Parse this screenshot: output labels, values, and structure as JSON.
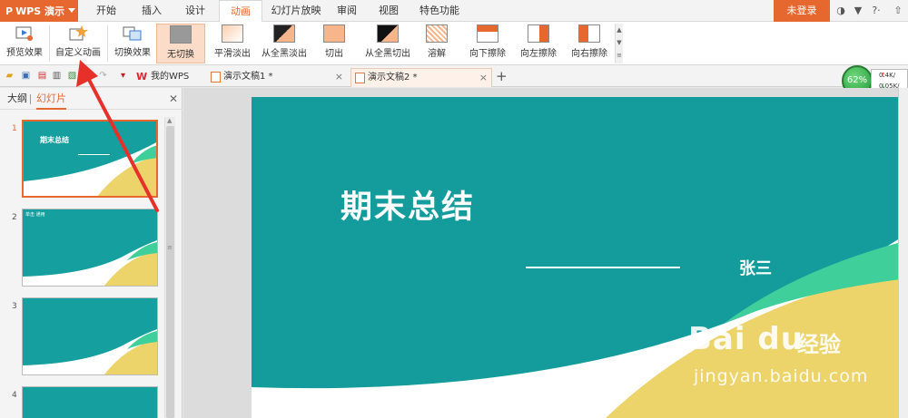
{
  "app": {
    "name": "WPS 演示",
    "logo": "P"
  },
  "menus": [
    {
      "label": "开始"
    },
    {
      "label": "插入"
    },
    {
      "label": "设计"
    },
    {
      "label": "动画"
    },
    {
      "label": "幻灯片放映"
    },
    {
      "label": "审阅"
    },
    {
      "label": "视图"
    },
    {
      "label": "特色功能"
    }
  ],
  "active_menu": "动画",
  "login_label": "未登录",
  "titlebar_icons": [
    "skin-icon",
    "shirt-icon",
    "help-icon",
    "collapse-icon"
  ],
  "ribbon": {
    "preview": "预览效果",
    "custom_animation": "自定义动画",
    "switch_effect": "切换效果",
    "transitions": [
      "无切换",
      "平滑淡出",
      "从全黑淡出",
      "切出",
      "从全黑切出",
      "溶解",
      "向下擦除",
      "向左擦除",
      "向右擦除"
    ]
  },
  "tabs": {
    "wps": "我的WPS",
    "doc1": "演示文稿1 *",
    "doc2": "演示文稿2 *"
  },
  "speed": {
    "percent": "62%",
    "up": "0.4K/",
    "down": "0.05K/"
  },
  "left_pane": {
    "outline_tab": "大纲",
    "slides_tab": "幻灯片"
  },
  "slides": [
    {
      "num": "1",
      "title": "期末总结"
    },
    {
      "num": "2",
      "title": "单击 通用"
    },
    {
      "num": "3"
    },
    {
      "num": "4"
    }
  ],
  "main_slide": {
    "title": "期末总结",
    "author": "张三"
  },
  "watermark": {
    "brand": "Bai du",
    "cn": "经验",
    "url": "jingyan.baidu.com"
  },
  "colors": {
    "accent": "#e7682e",
    "slide_teal": "#149c9c",
    "curve_yellow": "#ecd46a",
    "curve_green": "#3fcf9a",
    "arrow": "#e8302a"
  }
}
